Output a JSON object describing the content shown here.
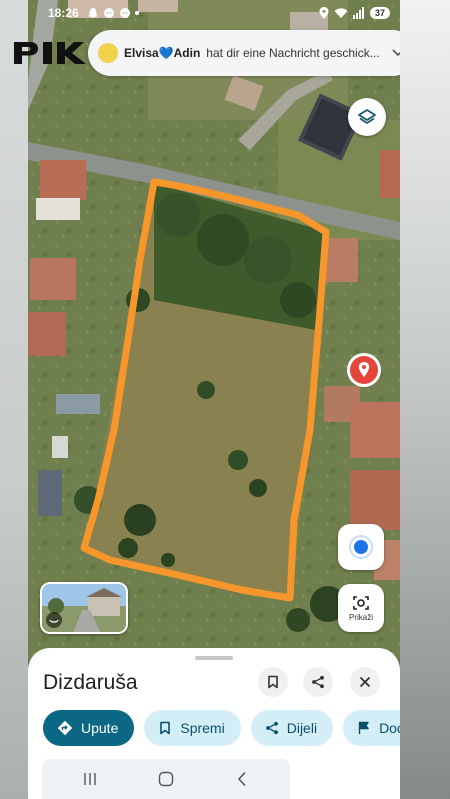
{
  "status_bar": {
    "time": "18:26",
    "battery": "37"
  },
  "watermark": {
    "text": "PIK"
  },
  "notification": {
    "sender": "Elvisa💙Adin",
    "text": "hat dir eine Nachricht geschick..."
  },
  "map": {
    "lens_label": "Prikaži"
  },
  "place": {
    "title": "Dizdaruša"
  },
  "actions": [
    {
      "label": "Upute",
      "icon": "directions-icon",
      "primary": true
    },
    {
      "label": "Spremi",
      "icon": "bookmark-icon"
    },
    {
      "label": "Dijeli",
      "icon": "share-icon"
    },
    {
      "label": "Dod",
      "icon": "flag-icon"
    }
  ],
  "colors": {
    "primary_chip": "#0b6783",
    "secondary_chip": "#d3eef6",
    "boundary": "#f7962a",
    "pin": "#e5453b",
    "location_dot": "#1a73e8"
  }
}
